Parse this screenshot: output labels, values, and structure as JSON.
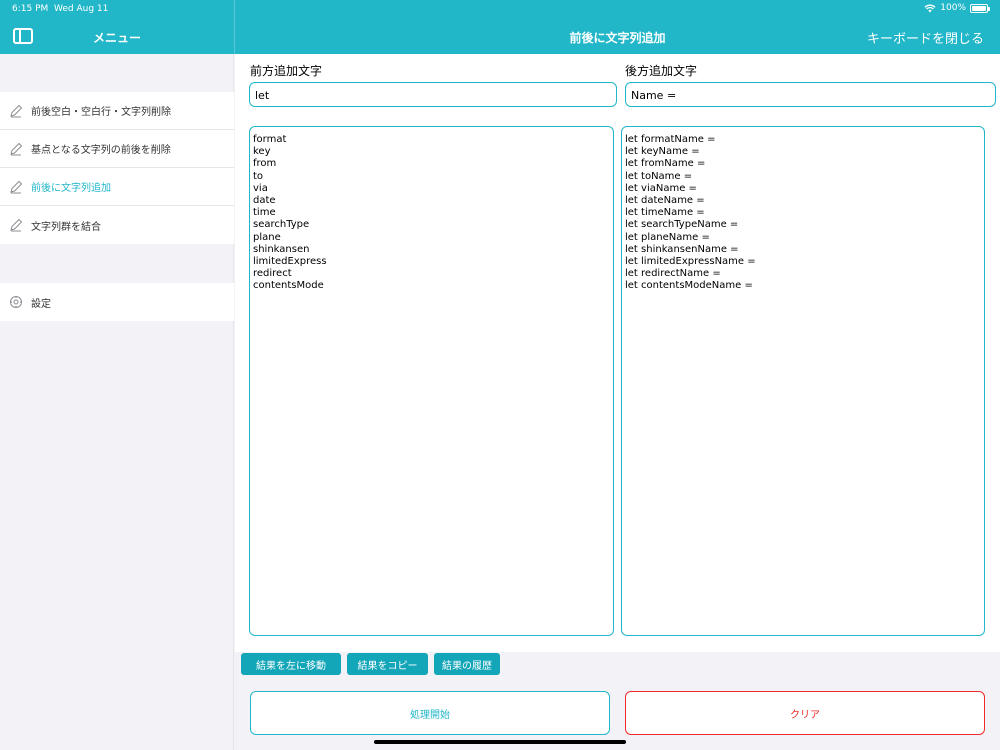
{
  "status": {
    "time": "6:15 PM",
    "date": "Wed Aug 11",
    "battery": "100%"
  },
  "nav": {
    "menu_title": "メニュー",
    "main_title": "前後に文字列追加",
    "close_keyboard": "キーボードを閉じる"
  },
  "sidebar": {
    "items": [
      {
        "label": "前後空白・空白行・文字列削除",
        "icon": "pencil-icon"
      },
      {
        "label": "基点となる文字列の前後を削除",
        "icon": "pencil-icon"
      },
      {
        "label": "前後に文字列追加",
        "icon": "pencil-icon",
        "active": true
      },
      {
        "label": "文字列群を結合",
        "icon": "pencil-icon"
      }
    ],
    "settings": {
      "label": "設定",
      "icon": "gear-icon"
    }
  },
  "form": {
    "prefix_label": "前方追加文字",
    "prefix_value": "let",
    "suffix_label": "後方追加文字",
    "suffix_value": "Name =",
    "input_lines": [
      "format",
      "key",
      "from",
      "to",
      "via",
      "date",
      "time",
      "searchType",
      "plane",
      "shinkansen",
      "limitedExpress",
      "redirect",
      "contentsMode"
    ],
    "output_lines": [
      "let formatName =",
      "let keyName =",
      "let fromName =",
      "let toName =",
      "let viaName =",
      "let dateName =",
      "let timeName =",
      "let searchTypeName =",
      "let planeName =",
      "let shinkansenName =",
      "let limitedExpressName =",
      "let redirectName =",
      "let contentsModeName ="
    ]
  },
  "buttons": {
    "move_left": "結果を左に移動",
    "copy": "結果をコピー",
    "history": "結果の履歴",
    "start": "処理開始",
    "clear": "クリア"
  },
  "colors": {
    "accent": "#21b6c8",
    "button": "#13a5b8",
    "danger": "#ef2b2b"
  }
}
